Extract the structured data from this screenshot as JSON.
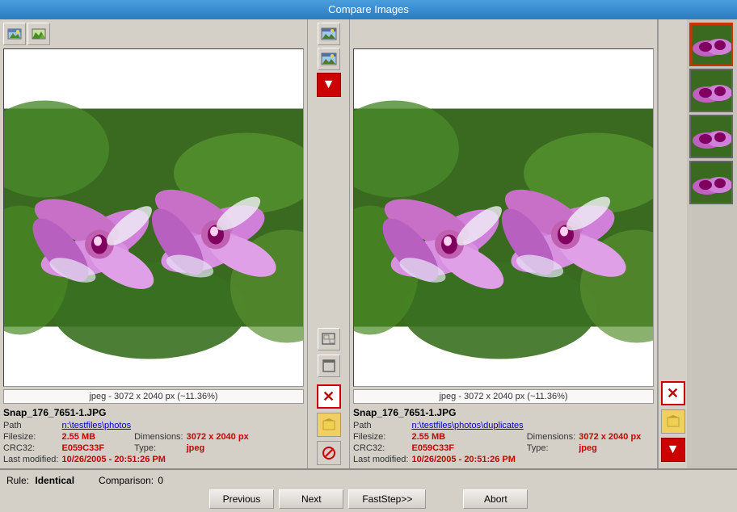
{
  "title": "Compare Images",
  "left": {
    "toolbar": {
      "btn1_icon": "🖼",
      "btn2_icon": "🏔"
    },
    "image_label": "jpeg - 3072 x 2040 px (~11.36%)",
    "filename": "Snap_176_7651-1.JPG",
    "path_label": "Path",
    "path_value": "n:\\testfiles\\photos",
    "filesize_label": "Filesize:",
    "filesize_value": "2.55 MB",
    "dimensions_label": "Dimensions:",
    "dimensions_value": "3072 x 2040 px",
    "crc_label": "CRC32:",
    "crc_value": "E059C33F",
    "type_label": "Type:",
    "type_value": "jpeg",
    "modified_label": "Last modified:",
    "modified_value": "10/26/2005 - 20:51:26 PM"
  },
  "right": {
    "image_label": "jpeg - 3072 x 2040 px (~11.36%)",
    "filename": "Snap_176_7651-1.JPG",
    "path_label": "Path",
    "path_value": "n:\\testfiles\\photos\\duplicates",
    "filesize_label": "Filesize:",
    "filesize_value": "2.55 MB",
    "dimensions_label": "Dimensions:",
    "dimensions_value": "3072 x 2040 px",
    "crc_label": "CRC32:",
    "crc_value": "E059C33F",
    "type_label": "Type:",
    "type_value": "jpeg",
    "modified_label": "Last modified:",
    "modified_value": "10/26/2005 - 20:51:26 PM"
  },
  "middle": {
    "sync_icon": "⊡",
    "maximize_icon": "⬜"
  },
  "bottom": {
    "rule_label": "Rule:",
    "rule_value": "Identical",
    "comparison_label": "Comparison:",
    "comparison_value": "0",
    "prev_label": "Previous",
    "next_label": "Next",
    "faststep_label": "FastStep>>",
    "abort_label": "Abort"
  },
  "thumbnails": [
    {
      "id": 1,
      "selected": true
    },
    {
      "id": 2,
      "selected": false
    },
    {
      "id": 3,
      "selected": false
    },
    {
      "id": 4,
      "selected": false
    }
  ]
}
